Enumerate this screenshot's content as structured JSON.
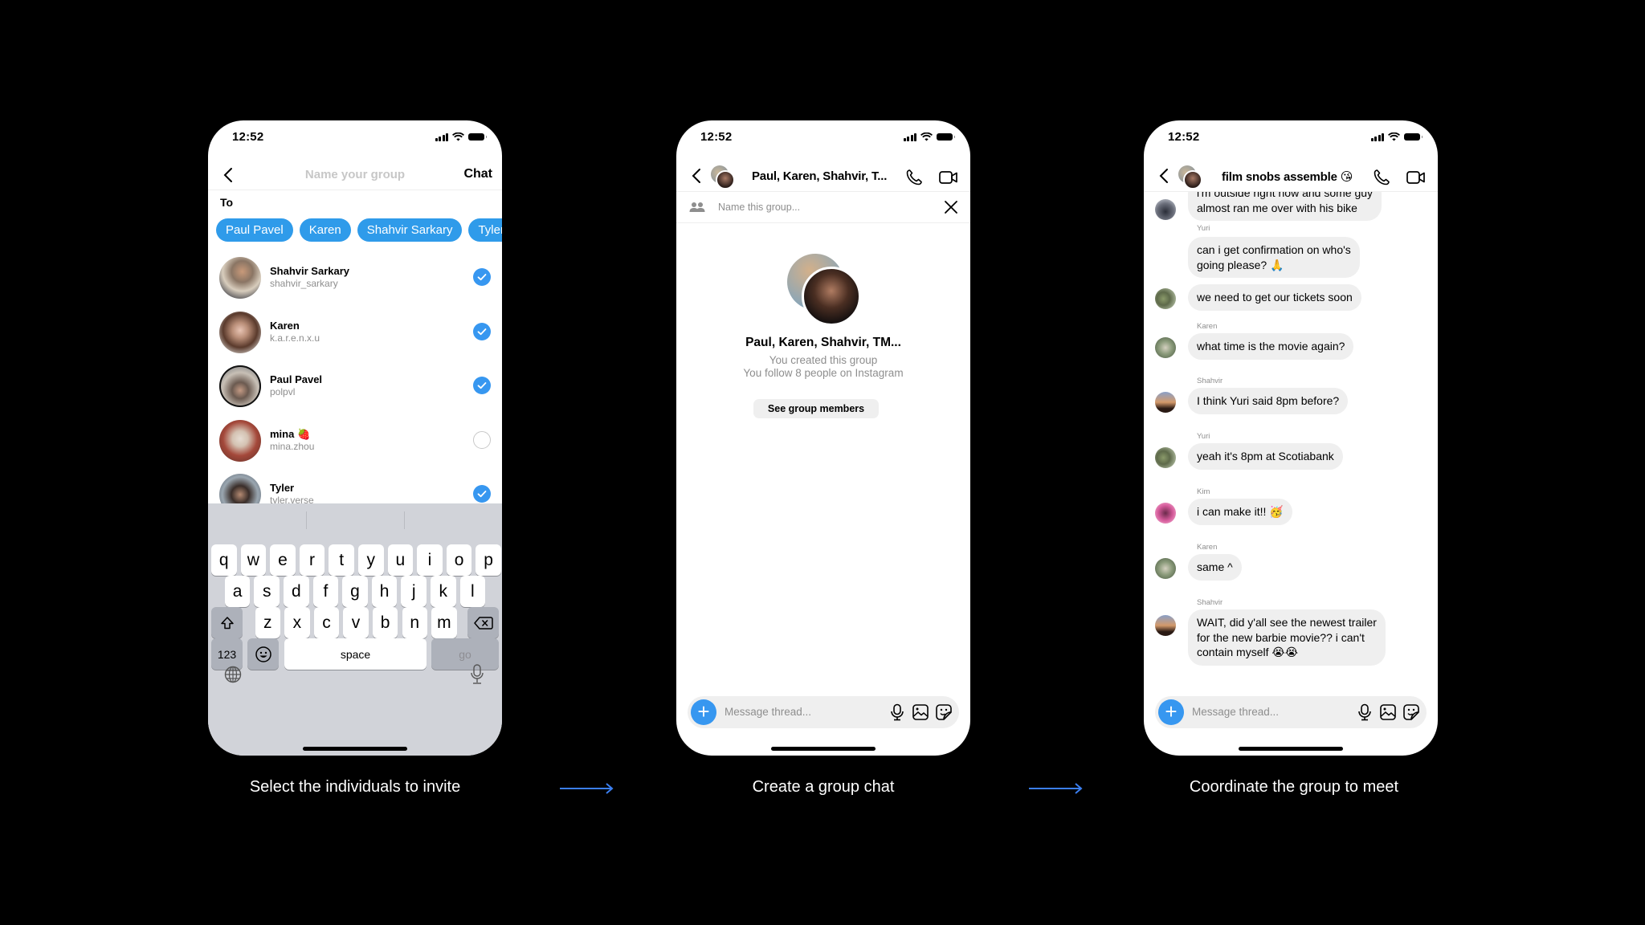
{
  "colors": {
    "background": "#000000",
    "accent_blue": "#3797f0",
    "chip_blue": "#2f9bea",
    "arrow_blue": "#3b7ff0",
    "bubble_gray": "#efefef"
  },
  "status_bar": {
    "time": "12:52",
    "icons": [
      "signal-icon",
      "wifi-icon",
      "battery-icon"
    ]
  },
  "steps": [
    {
      "caption": "Select the individuals to invite"
    },
    {
      "caption": "Create a group chat"
    },
    {
      "caption": "Coordinate the group to meet"
    }
  ],
  "arrows": [
    "arrow-right-icon",
    "arrow-right-icon"
  ],
  "screen1": {
    "back_icon": "chevron-left-icon",
    "title_placeholder": "Name your group",
    "chat_button": "Chat",
    "to_label": "To",
    "chips": [
      "Paul Pavel",
      "Karen",
      "Shahvir Sarkary",
      "Tyler"
    ],
    "contacts": [
      {
        "name": "Shahvir Sarkary",
        "username": "shahvir_sarkary",
        "selected": true
      },
      {
        "name": "Karen",
        "username": "k.a.r.e.n.x.u",
        "selected": true
      },
      {
        "name": "Paul Pavel",
        "username": "polpvl",
        "selected": true
      },
      {
        "name": "mina 🍓",
        "username": "mina.zhou",
        "selected": false
      },
      {
        "name": "Tyler",
        "username": "tyler.verse",
        "selected": true
      }
    ],
    "keyboard": {
      "row1": [
        "q",
        "w",
        "e",
        "r",
        "t",
        "y",
        "u",
        "i",
        "o",
        "p"
      ],
      "row2": [
        "a",
        "s",
        "d",
        "f",
        "g",
        "h",
        "j",
        "k",
        "l"
      ],
      "row3": [
        "z",
        "x",
        "c",
        "v",
        "b",
        "n",
        "m"
      ],
      "shift_icon": "shift-icon",
      "delete_icon": "backspace-icon",
      "numbers_key": "123",
      "emoji_icon": "emoji-icon",
      "space_key": "space",
      "go_key": "go",
      "globe_icon": "globe-icon",
      "dictation_icon": "microphone-icon"
    }
  },
  "screen2": {
    "header_title": "Paul, Karen, Shahvir, T...",
    "name_placeholder": "Name this group...",
    "group_title": "Paul, Karen, Shahvir, TM...",
    "created_text": "You created this group",
    "follow_text": "You follow 8 people on Instagram",
    "members_button": "See group members",
    "message_placeholder": "Message thread..."
  },
  "screen3": {
    "header_title": "film snobs assemble 😘",
    "message_placeholder": "Message thread...",
    "messages": [
      {
        "sender": "",
        "text": "i'm outside right now and some guy\nalmost ran me over with his bike",
        "avatar": true
      },
      {
        "sender": "Yuri",
        "text": "can i get confirmation on who's\ngoing please? 🙏",
        "avatar": false
      },
      {
        "sender": "",
        "text": "we need to get our tickets soon",
        "avatar": true
      },
      {
        "sender": "Karen",
        "text": "what time is the movie again?",
        "avatar": true
      },
      {
        "sender": "Shahvir",
        "text": "I think Yuri said 8pm before?",
        "avatar": true
      },
      {
        "sender": "Yuri",
        "text": "yeah it's 8pm at Scotiabank",
        "avatar": true
      },
      {
        "sender": "Kim",
        "text": "i can make it!! 🥳",
        "avatar": true
      },
      {
        "sender": "Karen",
        "text": "same ^",
        "avatar": true
      },
      {
        "sender": "Shahvir",
        "text": "WAIT, did y'all see the newest trailer\nfor the new barbie movie?? i can't\ncontain myself 😭😭",
        "avatar": true
      }
    ]
  }
}
